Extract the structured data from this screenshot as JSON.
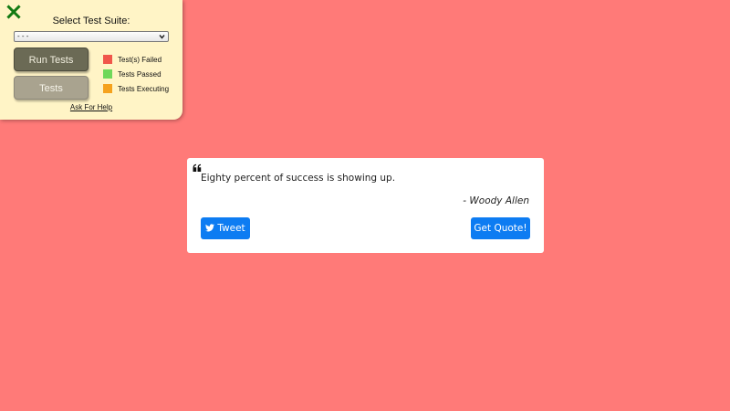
{
  "test_panel": {
    "title": "Select Test Suite:",
    "suite_select": {
      "selected": "- - -"
    },
    "run_button_label": "Run Tests",
    "tests_button_label": "Tests",
    "legend": [
      {
        "label": "Test(s) Failed",
        "color": "#f0564a"
      },
      {
        "label": "Tests Passed",
        "color": "#6fd85a"
      },
      {
        "label": "Tests Executing",
        "color": "#f5a21d"
      }
    ],
    "help_link": "Ask For Help",
    "close_icon": "close-x-icon",
    "close_color": "#127a12"
  },
  "quote": {
    "text": "Eighty percent of success is showing up.",
    "author": "- Woody Allen",
    "tweet_label": "Tweet",
    "get_quote_label": "Get Quote!",
    "accent_color": "#0d7cf2",
    "background_color": "#ff7a78"
  }
}
